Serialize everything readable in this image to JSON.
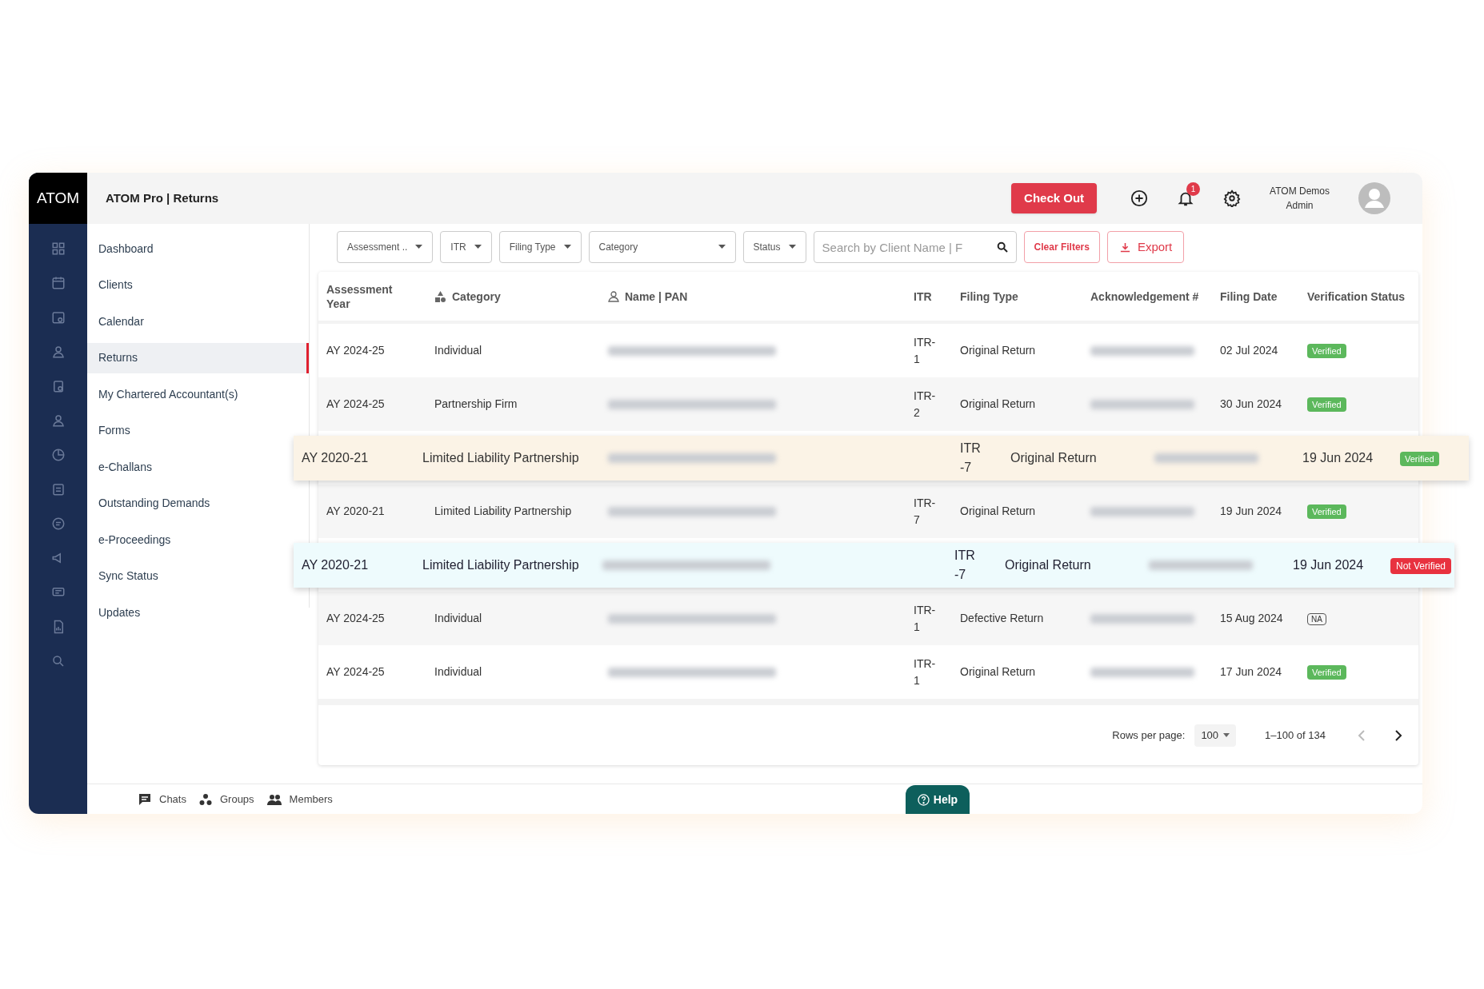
{
  "app": {
    "logo": "ATOM",
    "title": "ATOM Pro | Returns"
  },
  "header": {
    "checkout_button": "Check Out",
    "notification_count": "1",
    "user_name": "ATOM Demos",
    "user_role": "Admin"
  },
  "nav": [
    {
      "label": "Dashboard",
      "selected": false
    },
    {
      "label": "Clients",
      "selected": false
    },
    {
      "label": "Calendar",
      "selected": false
    },
    {
      "label": "Returns",
      "selected": true
    },
    {
      "label": "My Chartered Accountant(s)",
      "selected": false
    },
    {
      "label": "Forms",
      "selected": false
    },
    {
      "label": "e-Challans",
      "selected": false
    },
    {
      "label": "Outstanding Demands",
      "selected": false
    },
    {
      "label": "e-Proceedings",
      "selected": false
    },
    {
      "label": "Sync Status",
      "selected": false
    },
    {
      "label": "Updates",
      "selected": false
    }
  ],
  "filters": [
    {
      "label": "Assessment ..",
      "kind": "narrow"
    },
    {
      "label": "ITR",
      "kind": "narrow"
    },
    {
      "label": "Filing Type",
      "kind": "narrow"
    },
    {
      "label": "Category",
      "kind": "wide"
    },
    {
      "label": "Status",
      "kind": "narrow"
    }
  ],
  "search": {
    "placeholder": "Search by Client Name | F"
  },
  "actions": [
    {
      "label": "Clear Filters",
      "kind": "plain"
    },
    {
      "label": "Export",
      "kind": "download"
    }
  ],
  "table": {
    "columns": [
      {
        "label": "Assessment Year",
        "kind": "plain"
      },
      {
        "label": "Category",
        "kind": "shapes"
      },
      {
        "label": "Name | PAN",
        "kind": "person"
      },
      {
        "label": "ITR",
        "kind": "plain"
      },
      {
        "label": "Filing Type",
        "kind": "plain"
      },
      {
        "label": "Acknowledgement #",
        "kind": "plain"
      },
      {
        "label": "Filing Date",
        "kind": "plain"
      },
      {
        "label": "Verification Status",
        "kind": "plain"
      }
    ],
    "rows": [
      {
        "kind": "plain",
        "year": "AY 2024-25",
        "category": "Individual",
        "itr": "ITR-1",
        "filing_type": "Original Return",
        "filing_date": "02 Jul 2024",
        "status": {
          "text": "Verified",
          "kind": "verified"
        }
      },
      {
        "kind": "plain",
        "year": "AY 2024-25",
        "category": "Partnership Firm",
        "itr": "ITR-2",
        "filing_type": "Original Return",
        "filing_date": "30 Jun 2024",
        "status": {
          "text": "Verified",
          "kind": "verified"
        }
      },
      {
        "kind": "raised-warm",
        "year": "AY 2020-21",
        "category": "Limited Liability Partnership",
        "itr": "ITR-7",
        "filing_type": "Original Return",
        "filing_date": "19 Jun 2024",
        "status": {
          "text": "Verified",
          "kind": "verified"
        }
      },
      {
        "kind": "plain",
        "year": "AY 2020-21",
        "category": "Limited Liability Partnership",
        "itr": "ITR-7",
        "filing_type": "Original Return",
        "filing_date": "19 Jun 2024",
        "status": {
          "text": "Verified",
          "kind": "verified"
        }
      },
      {
        "kind": "raised-cool",
        "year": "AY 2020-21",
        "category": "Limited Liability Partnership",
        "itr": "ITR-7",
        "filing_type": "Original Return",
        "filing_date": "19 Jun 2024",
        "status": {
          "text": "Not Verified",
          "kind": "not_verified"
        }
      },
      {
        "kind": "plain",
        "year": "AY 2024-25",
        "category": "Individual",
        "itr": "ITR-1",
        "filing_type": "Defective Return",
        "filing_date": "15 Aug 2024",
        "status": {
          "text": "NA",
          "kind": "na"
        }
      },
      {
        "kind": "plain",
        "year": "AY 2024-25",
        "category": "Individual",
        "itr": "ITR-1",
        "filing_type": "Original Return",
        "filing_date": "17 Jun 2024",
        "status": {
          "text": "Verified",
          "kind": "verified"
        }
      }
    ]
  },
  "pagination": {
    "rows_label": "Rows per page:",
    "rows_value": "100",
    "range": "1–100 of 134"
  },
  "footer": {
    "links": [
      "Chats",
      "Groups",
      "Members"
    ],
    "help": "Help"
  }
}
